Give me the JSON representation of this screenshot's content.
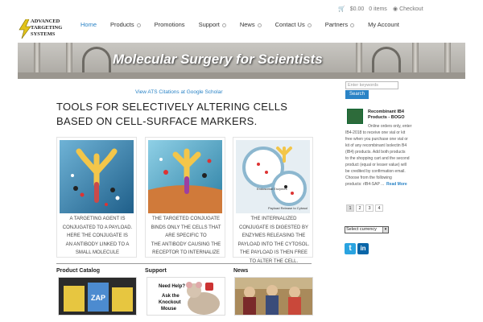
{
  "header": {
    "cart_total": "$0.00",
    "cart_items": "0 items",
    "checkout_label": "Checkout",
    "logo_lines": [
      "ADVANCED",
      "TARGETING",
      "SYSTEMS"
    ]
  },
  "nav": {
    "items": [
      {
        "label": "Home",
        "dropdown": false
      },
      {
        "label": "Products",
        "dropdown": true
      },
      {
        "label": "Promotions",
        "dropdown": false
      },
      {
        "label": "Support",
        "dropdown": true
      },
      {
        "label": "News",
        "dropdown": true
      },
      {
        "label": "Contact Us",
        "dropdown": true
      },
      {
        "label": "Partners",
        "dropdown": true
      },
      {
        "label": "My Account",
        "dropdown": false
      }
    ]
  },
  "banner": {
    "title": "Molecular Surgery for Scientists"
  },
  "main": {
    "citations_link": "View ATS Citations at Google Scholar",
    "headline_line1": "TOOLS FOR SELECTIVELY ALTERING CELLS",
    "headline_line2": "BASED ON CELL-SURFACE MARKERS.",
    "cards": [
      {
        "lines": [
          "A TARGETING AGENT IS",
          "CONJUGATED TO A PAYLOAD.",
          "HERE THE CONJUGATE IS",
          "AN ANTIBODY LINKED TO A",
          "SMALL MOLECULE"
        ]
      },
      {
        "lines": [
          "THE TARGETED CONJUGATE",
          "BINDS ONLY THE CELLS THAT",
          "ARE SPECIFIC TO",
          "THE ANTIBODY CAUSING THE",
          "RECEPTOR TO INTERNALIZE"
        ]
      },
      {
        "lines": [
          "THE INTERNALIZED",
          "CONJUGATE IS DIGESTED BY",
          "ENZYMES RELEASING THE",
          "PAYLOAD INTO THE CYTOSOL.",
          "THE PAYLOAD IS THEN FREE",
          "TO ALTER THE CELL."
        ],
        "image_labels": [
          "Endosomal Enzymes",
          "Payload Release to Cytosol"
        ]
      }
    ],
    "bottom_boxes": [
      {
        "title": "Product Catalog",
        "image_text": "ZAP"
      },
      {
        "title": "Support",
        "image_lines": [
          "Need Help?",
          "Ask the",
          "Knockout",
          "Mouse"
        ]
      },
      {
        "title": "News"
      }
    ]
  },
  "sidebar": {
    "search_placeholder": "Enter keywords",
    "search_button": "Search",
    "promo": {
      "title": "Recombinant IB4 Products - BOGO",
      "lines": [
        "Online orders only, enter",
        "IB4-2018 to receive one vial or kit",
        "free when you purchase one vial or",
        "kit of any recombinant Isolectin B4",
        "(IB4) products.       Add both products",
        "to the shopping cart and the second",
        "product (equal or lesser value) will",
        "be credited by confirmation email.",
        "Choose from the following",
        "products: rIB4-SAP ..."
      ],
      "more_label": "Read More"
    },
    "pages": [
      "1",
      "2",
      "3",
      "4"
    ],
    "current_page": "1",
    "currency_selected": "Select currency",
    "social": {
      "twitter_glyph": "t",
      "linkedin_glyph": "in"
    }
  },
  "colors": {
    "accent": "#2a83c6",
    "twitter": "#2aa3e0",
    "linkedin": "#0a66a8"
  }
}
